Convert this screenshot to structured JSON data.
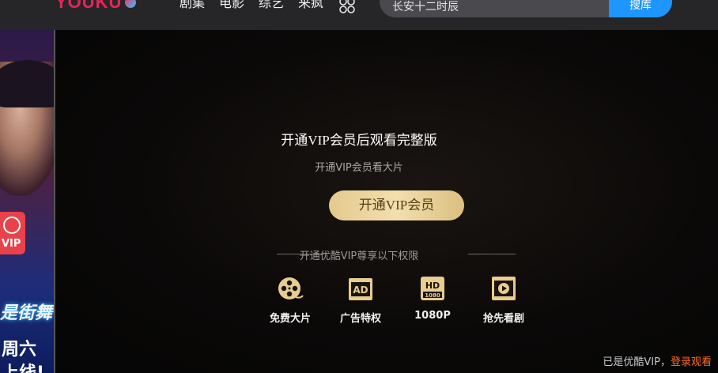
{
  "header": {
    "logo_text": "YOUKU",
    "nav": [
      "剧集",
      "电影",
      "综艺",
      "来疯"
    ],
    "search_value": "长安十二时辰",
    "search_button": "搜库"
  },
  "promo": {
    "vip_badge": "VIP",
    "script_text": "是街舞",
    "day_text": "周六",
    "online_text": "上线!"
  },
  "paywall": {
    "headline": "开通VIP会员后观看完整版",
    "subline": "开通VIP会员看大片",
    "cta_button": "开通VIP会员",
    "rights_title": "开通优酷VIP尊享以下权限",
    "benefits": [
      {
        "label": "免费大片",
        "icon": "film-reel-icon"
      },
      {
        "label": "广告特权",
        "icon": "ad-free-icon"
      },
      {
        "label": "1080P",
        "icon": "hd-1080p-icon"
      },
      {
        "label": "抢先看剧",
        "icon": "early-access-play-icon"
      }
    ],
    "footer_prefix": "已是优酷VIP，",
    "footer_link": "登录观看"
  },
  "colors": {
    "accent_gold": "#e8cc90",
    "search_blue": "#1f95ff",
    "link_orange": "#ff6b2c"
  }
}
